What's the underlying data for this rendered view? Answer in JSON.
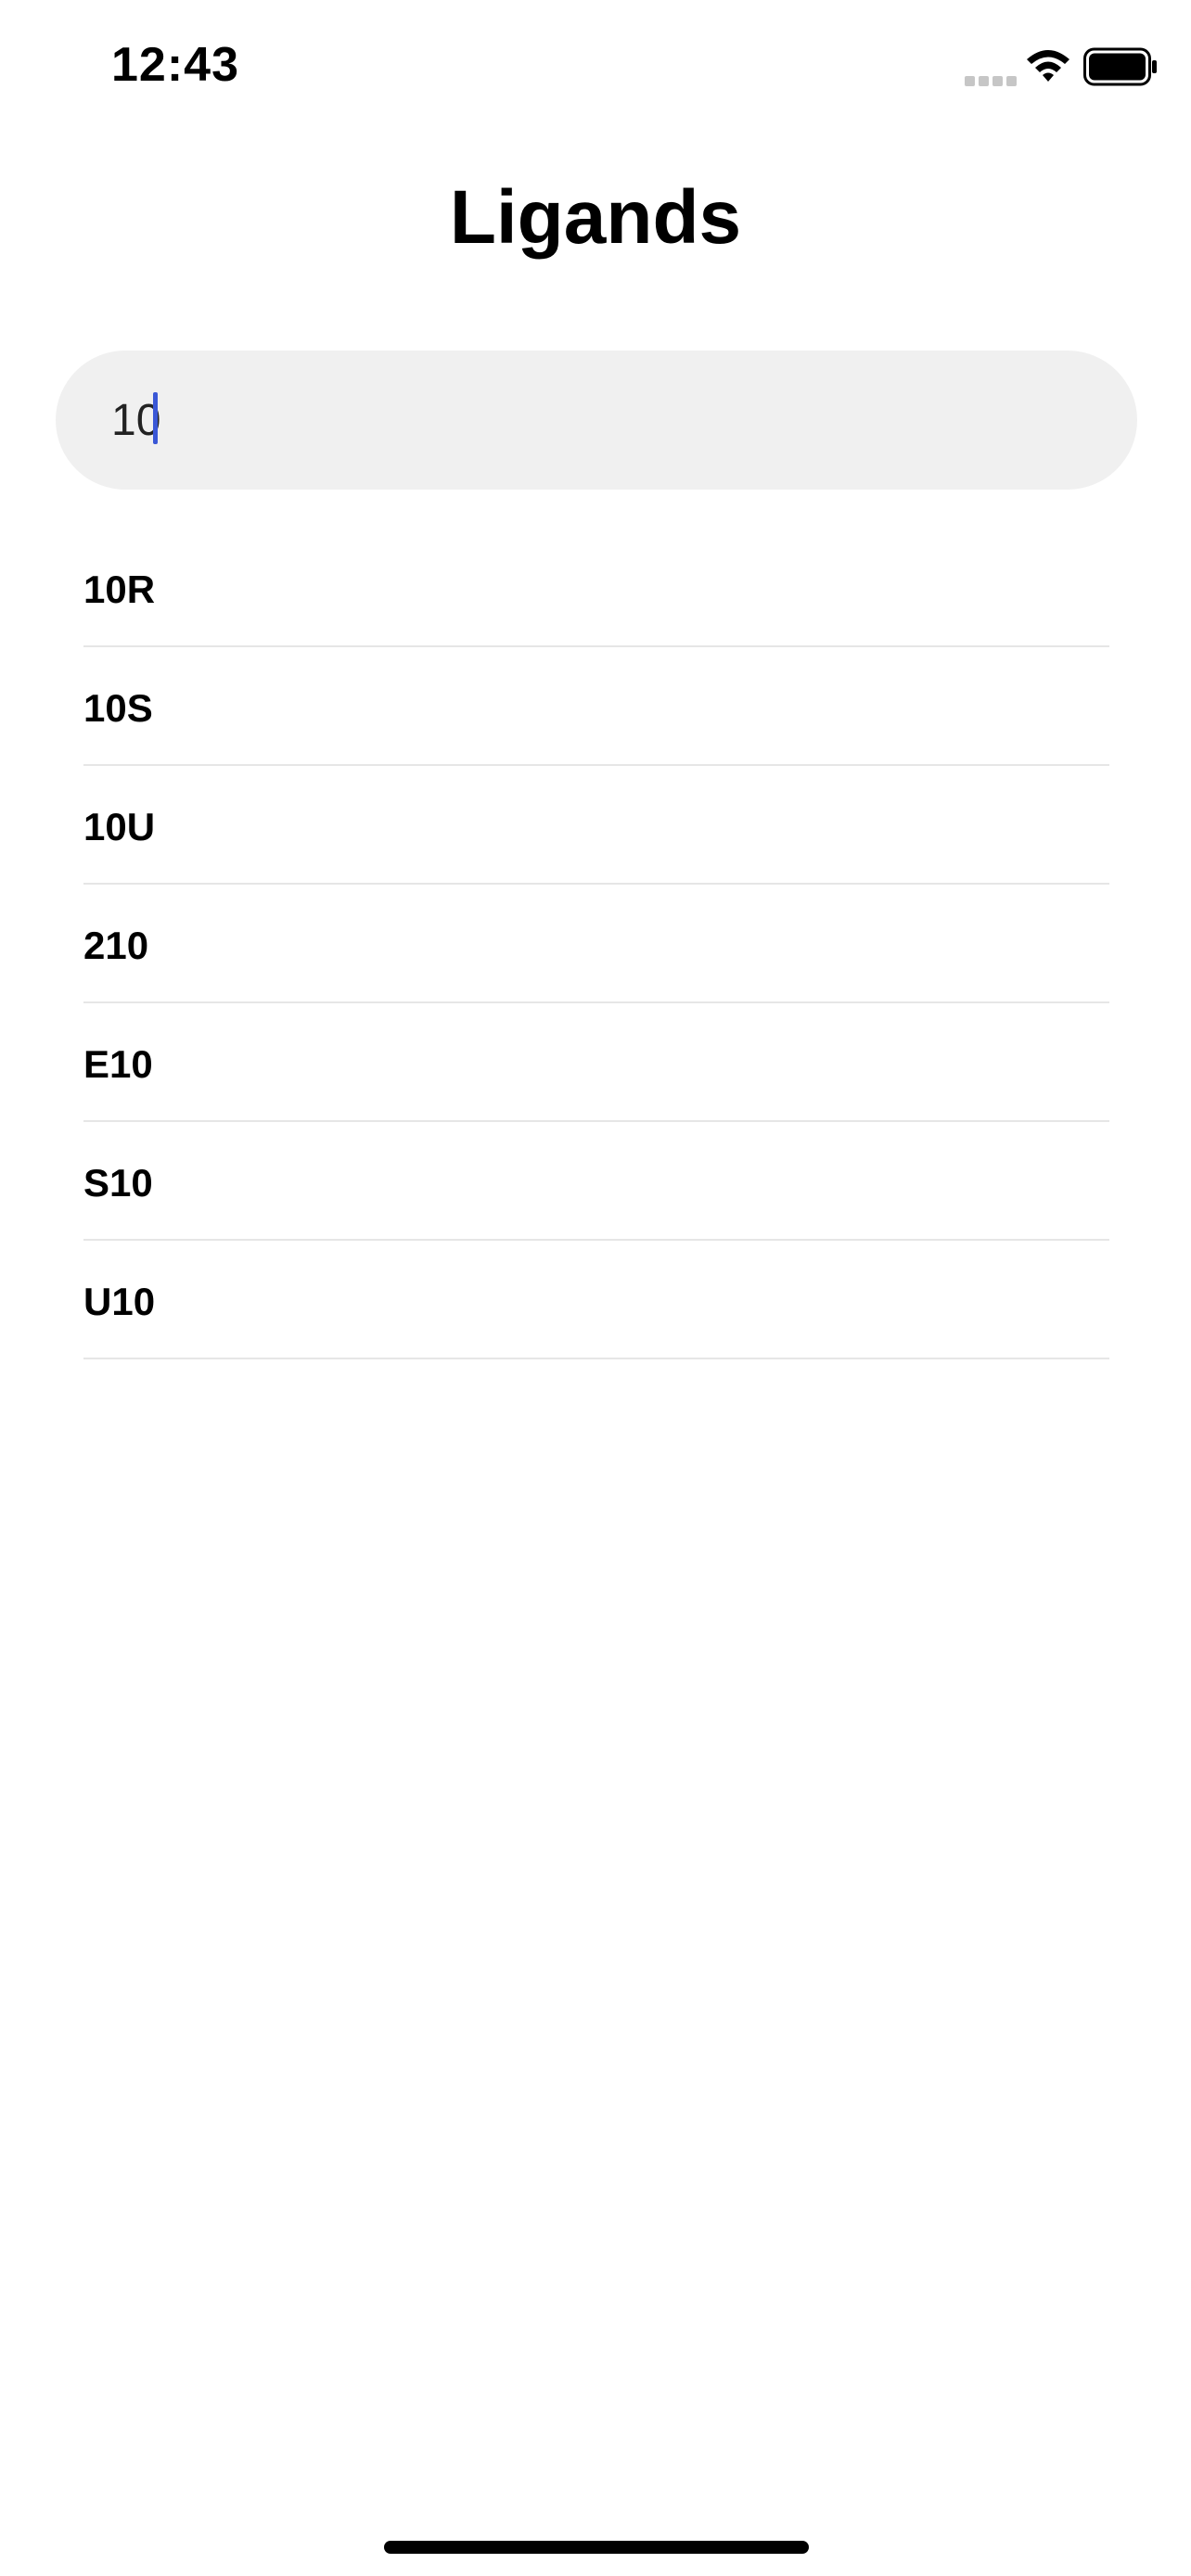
{
  "status_bar": {
    "time": "12:43",
    "icons": [
      "signal-icon",
      "wifi-icon",
      "battery-icon"
    ]
  },
  "page": {
    "title": "Ligands"
  },
  "search": {
    "value": "10",
    "placeholder": ""
  },
  "results": [
    {
      "label": "10R"
    },
    {
      "label": "10S"
    },
    {
      "label": "10U"
    },
    {
      "label": "210"
    },
    {
      "label": "E10"
    },
    {
      "label": "S10"
    },
    {
      "label": "U10"
    }
  ],
  "colors": {
    "search_background": "#f0f0f0",
    "caret": "#3a57d6",
    "divider": "#e6e6e6"
  }
}
